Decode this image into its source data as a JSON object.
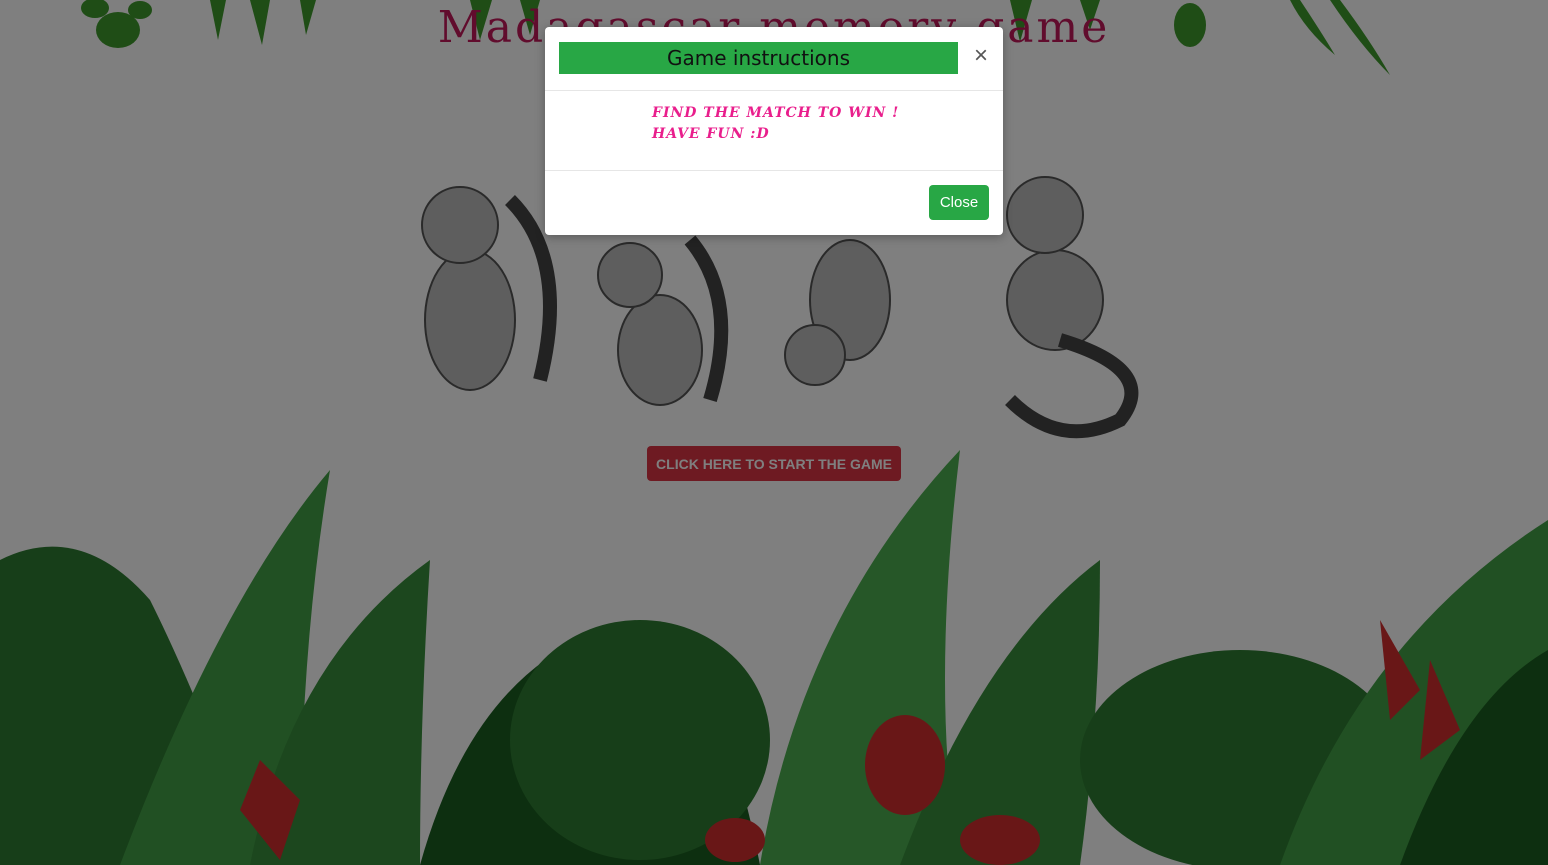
{
  "page": {
    "title": "Madagascar memory game",
    "start_button_label": "CLICK HERE TO START THE GAME"
  },
  "modal": {
    "title": "Game instructions",
    "close_icon": "×",
    "instructions": [
      "FIND THE MATCH TO WIN !",
      "HAVE FUN :D"
    ],
    "close_button_label": "Close"
  },
  "colors": {
    "modal_header_bg": "#28a745",
    "close_button_bg": "#28a745",
    "start_button_bg": "#dc3545",
    "instruction_text": "#e91e8c",
    "title_text": "#c2185b",
    "backdrop": "rgba(0,0,0,0.5)"
  },
  "icons": [
    "close-icon",
    "jungle-foliage-illustration",
    "lemur-illustration"
  ]
}
